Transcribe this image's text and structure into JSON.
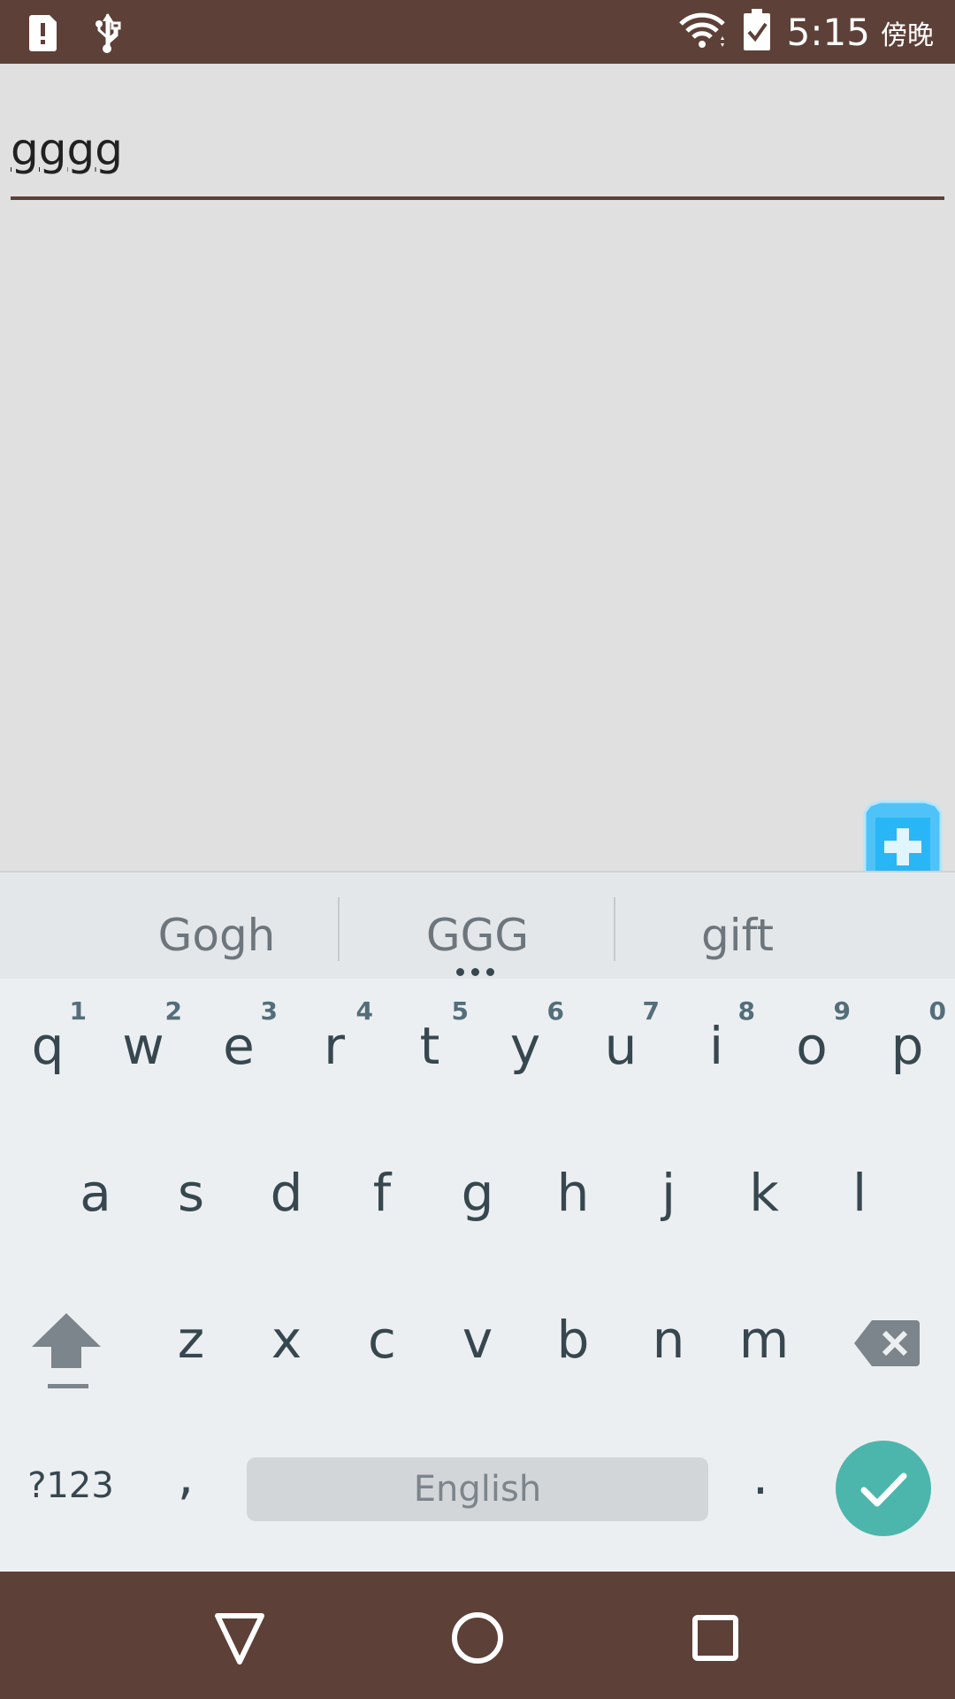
{
  "status_bar": {
    "time": "5:15",
    "ampm": "傍晚",
    "icons": [
      "sd-card-alert-icon",
      "usb-icon",
      "wifi-icon",
      "battery-icon"
    ]
  },
  "editor": {
    "text": "gggg"
  },
  "keyboard": {
    "suggestions": [
      "Gogh",
      "GGG",
      "gift"
    ],
    "row1": [
      {
        "key": "q",
        "hint": "1"
      },
      {
        "key": "w",
        "hint": "2"
      },
      {
        "key": "e",
        "hint": "3"
      },
      {
        "key": "r",
        "hint": "4"
      },
      {
        "key": "t",
        "hint": "5"
      },
      {
        "key": "y",
        "hint": "6"
      },
      {
        "key": "u",
        "hint": "7"
      },
      {
        "key": "i",
        "hint": "8"
      },
      {
        "key": "o",
        "hint": "9"
      },
      {
        "key": "p",
        "hint": "0"
      }
    ],
    "row2": [
      "a",
      "s",
      "d",
      "f",
      "g",
      "h",
      "j",
      "k",
      "l"
    ],
    "row3": [
      "z",
      "x",
      "c",
      "v",
      "b",
      "n",
      "m"
    ],
    "symbols_label": "?123",
    "comma": ",",
    "space_label": "English",
    "period": ".",
    "accent_color": "#4db6ac"
  },
  "colors": {
    "status_bar": "#5d4037",
    "background": "#e0e0e0",
    "keyboard": "#eceff1"
  }
}
